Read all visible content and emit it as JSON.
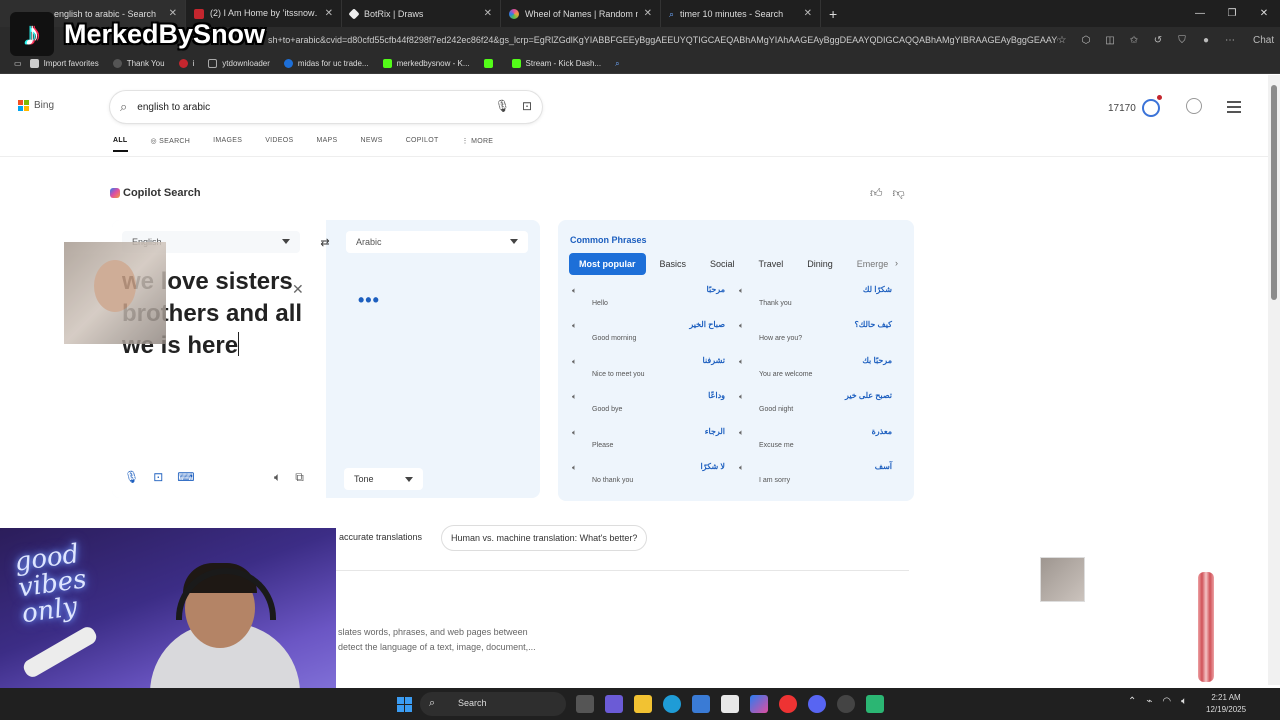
{
  "browser": {
    "tabs": [
      {
        "title": "english to arabic - Search",
        "color": "#1d6fd8"
      },
      {
        "title": "(2) I Am Home by ’​itssnow․ 🐾",
        "color": "#c4262e"
      },
      {
        "title": "BotRix | Draws",
        "color": "#eeeeee"
      },
      {
        "title": "Wheel of Names | Random name",
        "color": "#e04ea0"
      },
      {
        "title": "timer 10 minutes - Search",
        "color": "#1d6fd8"
      }
    ],
    "url": "sh+to+arabic&cvid=d80cfd55cfb44f8298f7ed242ec86f24&gs_lcrp=EgRlZGdlKgYIABBFGEEyBggAEEUYQTIGCAEQABhAMgYIAhAAGEAyBggDEAAYQDIGCAQQABhAMgYIBRAAGEAyBggGEAAYQDIGCAcQABhAMgYICBAAGEDSAQ",
    "copilot_label": "Chat",
    "bookmarks": [
      {
        "label": "Import favorites",
        "color": "#cccccc"
      },
      {
        "label": "Thank You",
        "color": "#333333"
      },
      {
        "label": "i",
        "color": "#c4262e"
      },
      {
        "label": "ytdownloader",
        "color": "#777777"
      },
      {
        "label": "midas for uc trade...",
        "color": "#1d6fd8"
      },
      {
        "label": "merkedbysnow - K...",
        "color": "#53fc18"
      },
      {
        "label": "",
        "color": "#53fc18"
      },
      {
        "label": "Stream - Kick Dash...",
        "color": "#53fc18"
      }
    ]
  },
  "bing": {
    "logo": "Bing",
    "search_query": "english to arabic",
    "nav": [
      "ALL",
      "SEARCH",
      "IMAGES",
      "VIDEOS",
      "MAPS",
      "NEWS",
      "COPILOT",
      "MORE"
    ],
    "rewards_points": "17170",
    "copilot_title": "Copilot Search",
    "translator": {
      "source_lang": "English",
      "target_lang": "Arabic",
      "source_text": "we love sisters brothers and all we is here",
      "loading": "•••",
      "tone": "Tone"
    },
    "common_phrases": {
      "title": "Common Phrases",
      "tabs": [
        "Most popular",
        "Basics",
        "Social",
        "Travel",
        "Dining",
        "Emerge"
      ],
      "rows": [
        [
          {
            "ar": "مرحبًا",
            "en": "Hello"
          },
          {
            "ar": "شكرًا لك",
            "en": "Thank you"
          }
        ],
        [
          {
            "ar": "صباح الخير",
            "en": "Good morning"
          },
          {
            "ar": "كيف حالك؟",
            "en": "How are you?"
          }
        ],
        [
          {
            "ar": "تشرفنا",
            "en": "Nice to meet you"
          },
          {
            "ar": "مرحبًا بك",
            "en": "You are welcome"
          }
        ],
        [
          {
            "ar": "وداعًا",
            "en": "Good bye"
          },
          {
            "ar": "تصبح على خير",
            "en": "Good night"
          }
        ],
        [
          {
            "ar": "الرجاء",
            "en": "Please"
          },
          {
            "ar": "معذرة",
            "en": "Excuse me"
          }
        ],
        [
          {
            "ar": "لا شكرًا",
            "en": "No thank you"
          },
          {
            "ar": "آسف",
            "en": "I am sorry"
          }
        ]
      ]
    },
    "pills": [
      "accurate translations",
      "Human vs. machine translation: What's better?"
    ],
    "desc_lines": [
      "slates words, phrases, and web pages between",
      "detect the language of a text, image, document,..."
    ]
  },
  "overlay": {
    "channel": "MerkedBySnow",
    "neon_text": "good vibes only"
  },
  "taskbar": {
    "search_label": "Search",
    "time": "2:21 AM",
    "date": "12/19/2025"
  },
  "colors": {
    "accent": "#1d6fd8",
    "brand_blue": "#1d5fbf"
  }
}
